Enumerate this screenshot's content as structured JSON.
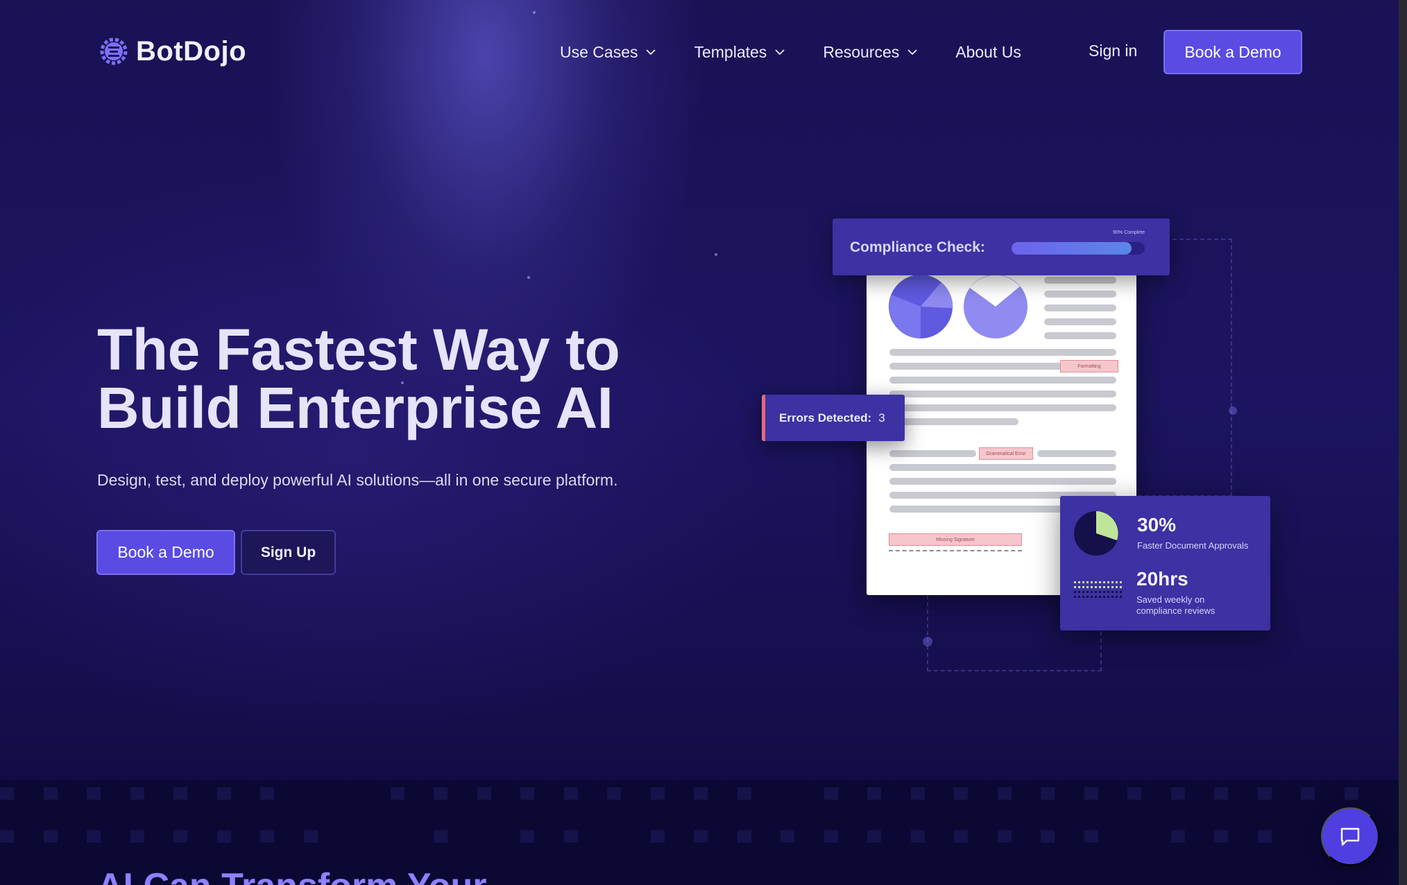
{
  "brand": {
    "name": "BotDojo",
    "accent": "#5a4be3"
  },
  "nav": {
    "items": [
      {
        "label": "Use Cases",
        "dropdown": true
      },
      {
        "label": "Templates",
        "dropdown": true
      },
      {
        "label": "Resources",
        "dropdown": true
      },
      {
        "label": "About Us",
        "dropdown": false
      }
    ],
    "sign_in": "Sign in",
    "cta": "Book a Demo"
  },
  "hero": {
    "title_line1": "The Fastest Way to",
    "title_line2": "Build Enterprise AI",
    "subtitle": "Design, test, and deploy powerful AI solutions—all in one secure platform.",
    "primary_cta": "Book a Demo",
    "secondary_cta": "Sign Up"
  },
  "illustration": {
    "compliance": {
      "label": "Compliance Check:",
      "progress_text": "90% Complete",
      "progress": 0.9
    },
    "errors": {
      "label": "Errors Detected:",
      "count": "3"
    },
    "tags": {
      "formatting": "Formatting",
      "grammar": "Grammatical Error",
      "signature": "Missing Signature"
    },
    "stat1": {
      "value": "30%",
      "caption": "Faster Document Approvals"
    },
    "stat2": {
      "value": "20hrs",
      "caption_line1": "Saved weekly on",
      "caption_line2": "compliance reviews"
    }
  },
  "lower": {
    "title": "AI Can Transform Your"
  },
  "chat": {
    "icon": "chat-bubble-icon"
  }
}
